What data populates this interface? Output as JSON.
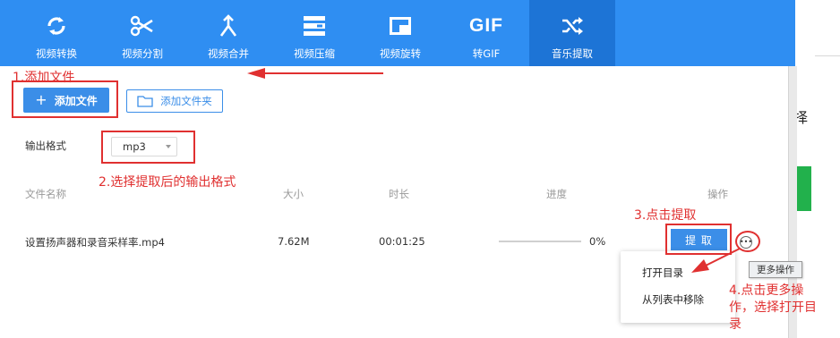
{
  "toolbar": {
    "tabs": [
      {
        "label": "视频转换",
        "icon": "refresh-icon"
      },
      {
        "label": "视频分割",
        "icon": "scissors-icon"
      },
      {
        "label": "视频合并",
        "icon": "merge-icon"
      },
      {
        "label": "视频压缩",
        "icon": "compress-icon"
      },
      {
        "label": "视频旋转",
        "icon": "rotate-icon"
      },
      {
        "label": "转GIF",
        "icon": "gif-icon",
        "icon_text": "GIF"
      },
      {
        "label": "音乐提取",
        "icon": "shuffle-icon",
        "active": true
      }
    ]
  },
  "actions": {
    "add_file": "添加文件",
    "add_folder": "添加文件夹"
  },
  "format": {
    "label": "输出格式",
    "value": "mp3"
  },
  "table": {
    "headers": [
      "文件名称",
      "大小",
      "时长",
      "进度",
      "操作"
    ],
    "rows": [
      {
        "name": "设置扬声器和录音采样率.mp4",
        "size": "7.62M",
        "duration": "00:01:25",
        "progress": 0,
        "progress_text": "0%",
        "action": "提 取"
      }
    ]
  },
  "tooltip": "更多操作",
  "menu": {
    "items": [
      "打开目录",
      "从列表中移除"
    ]
  },
  "side": {
    "char": "择"
  },
  "annotations": {
    "step1": "1.添加文件",
    "step2": "2.选择提取后的输出格式",
    "step3": "3.点击提取",
    "step4_line1": "4.点击更多操",
    "step4_line2": "作，选择打开目",
    "step4_line3": "录"
  },
  "colors": {
    "toolbar": "#2f8ef2",
    "active_tab": "#1d74d6",
    "primary": "#3b8ee8",
    "annotation": "#e03030"
  }
}
